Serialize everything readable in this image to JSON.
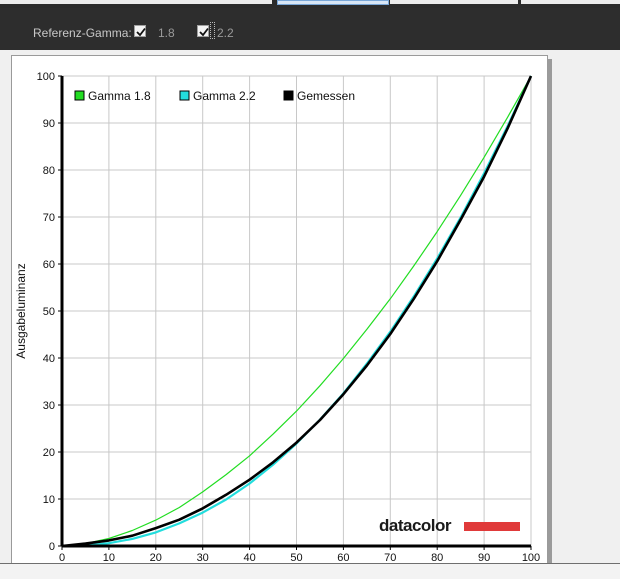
{
  "toolbar": {
    "label": "Referenz-Gamma:",
    "option1": {
      "label": "1.8",
      "checked": true
    },
    "option2": {
      "label": "2.2",
      "checked": true
    }
  },
  "logo": {
    "text": "datacolor",
    "bar_color": "#e03a3a"
  },
  "chart_data": {
    "type": "line",
    "title": "",
    "xlabel": "",
    "ylabel": "Ausgabeluminanz",
    "xlim": [
      0,
      100
    ],
    "ylim": [
      0,
      100
    ],
    "x_ticks": [
      0,
      10,
      20,
      30,
      40,
      50,
      60,
      70,
      80,
      90,
      100
    ],
    "y_ticks": [
      0,
      10,
      20,
      30,
      40,
      50,
      60,
      70,
      80,
      90,
      100
    ],
    "grid": true,
    "legend_position": "top-left",
    "series": [
      {
        "name": "Gamma 1.8",
        "color": "#22dd22",
        "x": [
          0,
          5,
          10,
          15,
          20,
          25,
          30,
          35,
          40,
          45,
          50,
          55,
          60,
          65,
          70,
          75,
          80,
          85,
          90,
          95,
          100
        ],
        "y": [
          0,
          0.5,
          1.6,
          3.3,
          5.5,
          8.2,
          11.5,
          15.2,
          19.2,
          23.8,
          28.7,
          34.1,
          39.9,
          46.1,
          52.6,
          59.6,
          66.9,
          74.6,
          82.7,
          91.2,
          100
        ]
      },
      {
        "name": "Gamma 2.2",
        "color": "#22dddd",
        "x": [
          0,
          5,
          10,
          15,
          20,
          25,
          30,
          35,
          40,
          45,
          50,
          55,
          60,
          65,
          70,
          75,
          80,
          85,
          90,
          95,
          100
        ],
        "y": [
          0,
          0.1,
          0.6,
          1.5,
          2.9,
          4.8,
          7.1,
          9.9,
          13.3,
          17.3,
          21.8,
          26.9,
          32.5,
          38.8,
          45.6,
          53.1,
          61.2,
          69.9,
          79.3,
          89.3,
          100
        ]
      },
      {
        "name": "Gemessen",
        "color": "#000000",
        "x": [
          0,
          5,
          10,
          15,
          20,
          25,
          30,
          35,
          40,
          45,
          50,
          55,
          60,
          65,
          70,
          75,
          80,
          85,
          90,
          95,
          100
        ],
        "y": [
          0,
          0.5,
          1.2,
          2.2,
          3.8,
          5.6,
          8.0,
          10.9,
          14.1,
          17.8,
          22.0,
          26.8,
          32.3,
          38.4,
          45.1,
          52.6,
          60.6,
          69.4,
          78.6,
          88.8,
          100
        ]
      }
    ]
  }
}
